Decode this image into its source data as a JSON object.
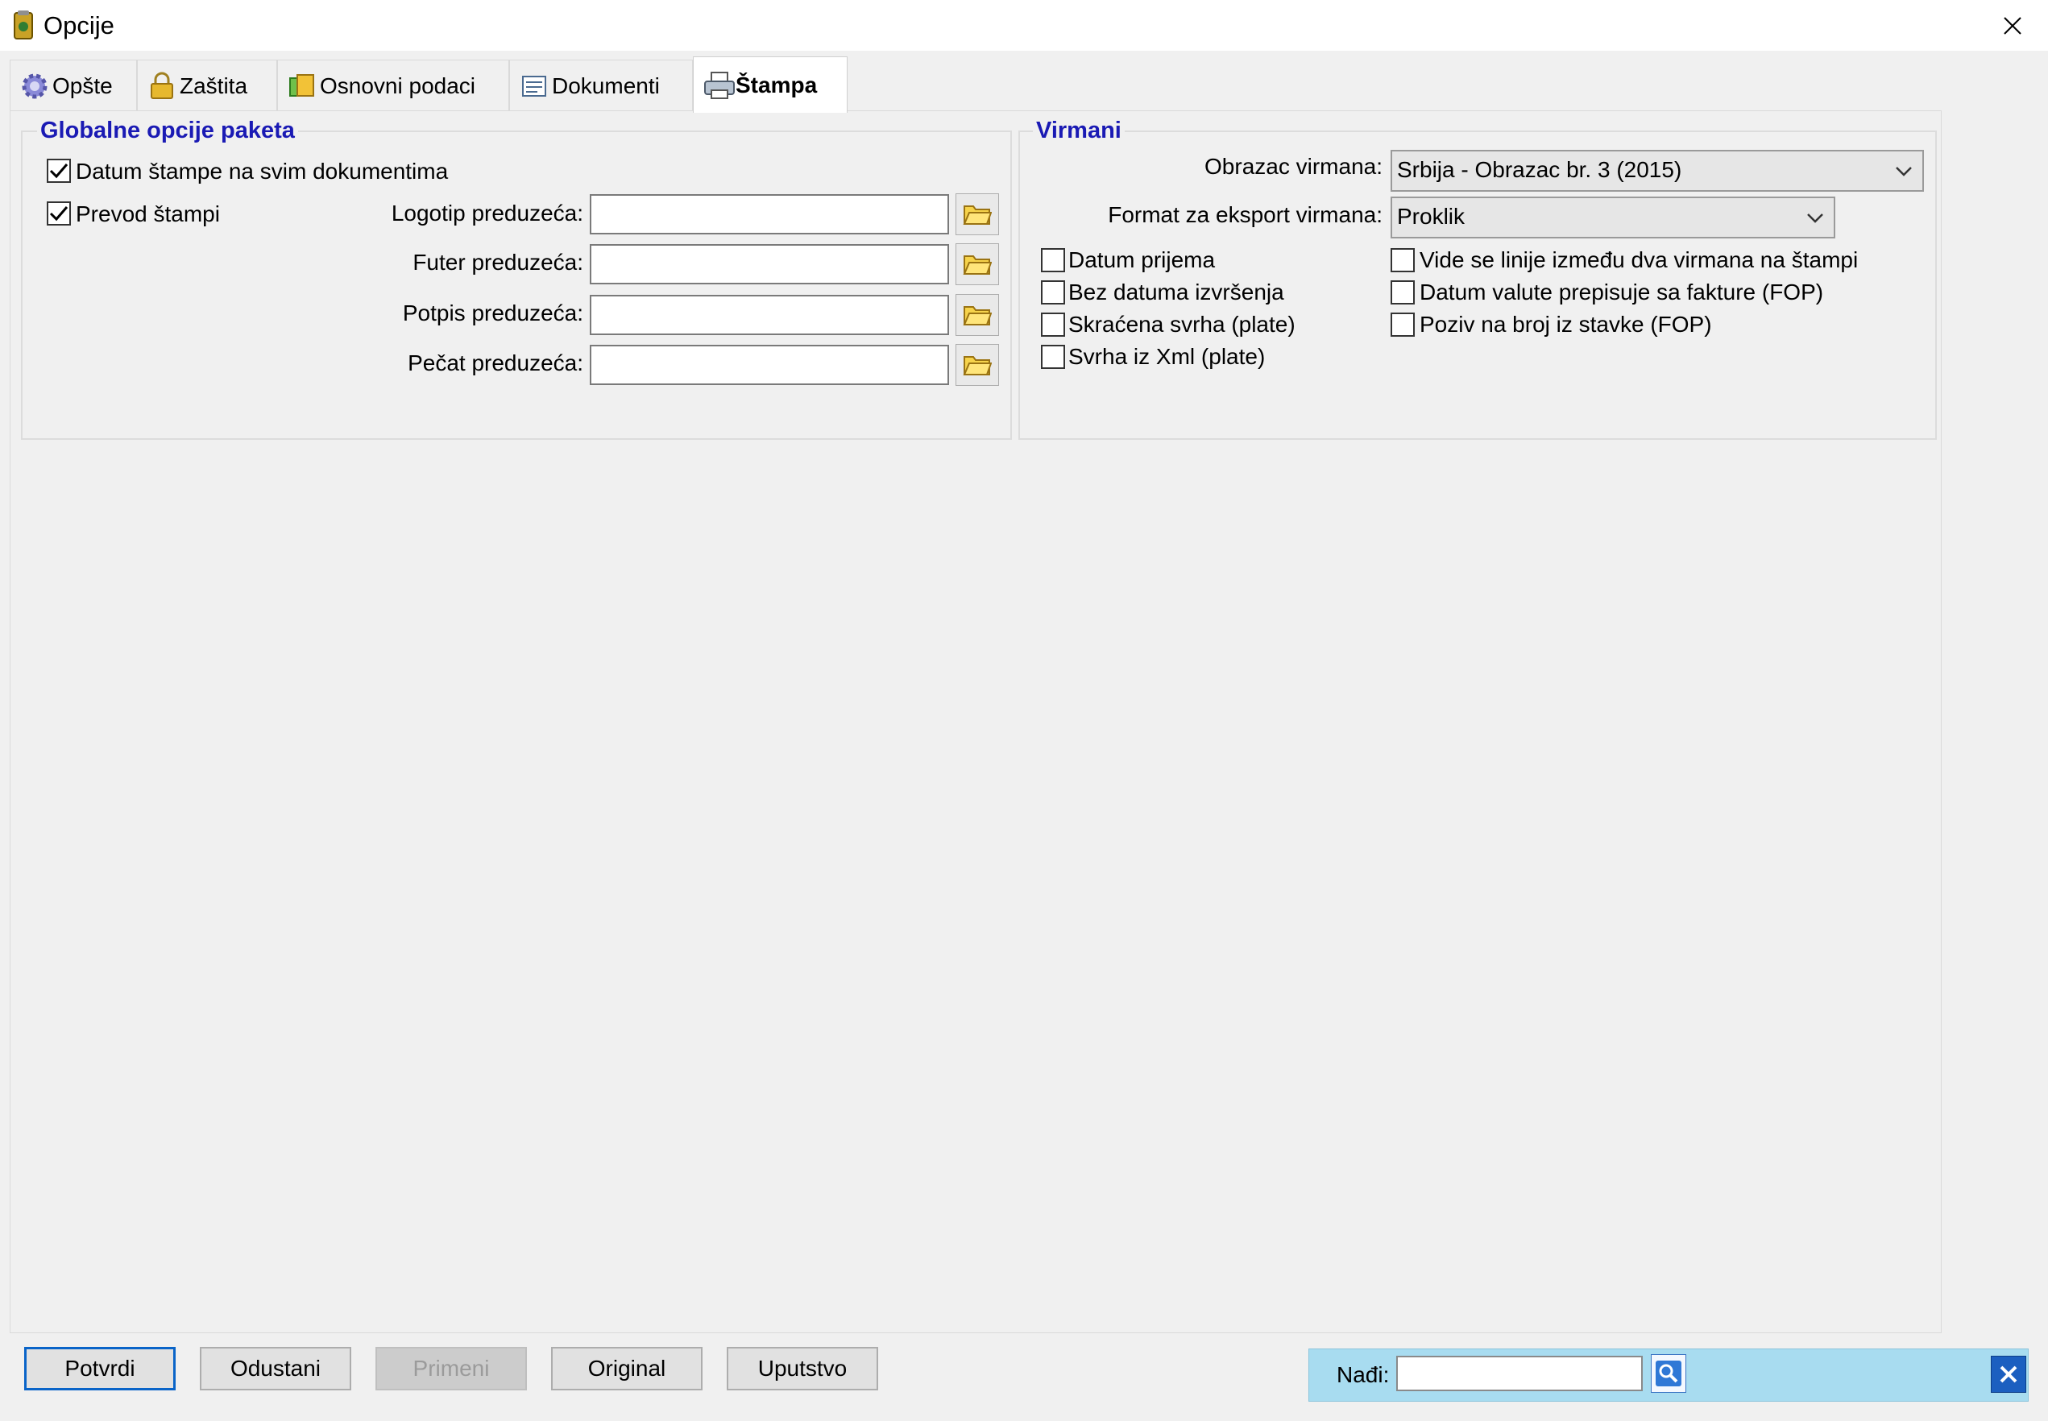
{
  "window": {
    "title": "Opcije"
  },
  "tabs": [
    {
      "label": "Opšte",
      "icon": "gear-icon"
    },
    {
      "label": "Zaštita",
      "icon": "lock-icon"
    },
    {
      "label": "Osnovni podaci",
      "icon": "database-icon"
    },
    {
      "label": "Dokumenti",
      "icon": "document-icon"
    },
    {
      "label": "Štampa",
      "icon": "printer-icon",
      "active": true
    }
  ],
  "global_group": {
    "title": "Globalne opcije paketa",
    "datum_stampe": {
      "label": "Datum štampe na svim dokumentima",
      "checked": true
    },
    "prevod_stampi": {
      "label": "Prevod štampi",
      "checked": true
    },
    "fields": [
      {
        "label": "Logotip preduzeća:",
        "value": ""
      },
      {
        "label": "Futer preduzeća:",
        "value": ""
      },
      {
        "label": "Potpis preduzeća:",
        "value": ""
      },
      {
        "label": "Pečat preduzeća:",
        "value": ""
      }
    ]
  },
  "virmani_group": {
    "title": "Virmani",
    "obrazac": {
      "label": "Obrazac virmana:",
      "value": "Srbija - Obrazac br. 3 (2015)"
    },
    "format": {
      "label": "Format za eksport virmana:",
      "value": "Proklik"
    },
    "left_checks": [
      {
        "label": "Datum prijema",
        "checked": false
      },
      {
        "label": "Bez datuma izvršenja",
        "checked": false
      },
      {
        "label": "Skraćena svrha (plate)",
        "checked": false
      },
      {
        "label": "Svrha iz Xml (plate)",
        "checked": false
      }
    ],
    "right_checks": [
      {
        "label": "Vide se linije između dva virmana na štampi",
        "checked": false
      },
      {
        "label": "Datum valute prepisuje sa fakture (FOP)",
        "checked": false
      },
      {
        "label": "Poziv na broj iz stavke (FOP)",
        "checked": false
      }
    ]
  },
  "buttons": {
    "potvrdi": "Potvrdi",
    "odustani": "Odustani",
    "primeni": "Primeni",
    "original": "Original",
    "uputstvo": "Uputstvo"
  },
  "find": {
    "label": "Nađi:",
    "value": ""
  },
  "colors": {
    "group_title": "#1a1ab4",
    "find_bar": "#a8dcf0",
    "default_button_border": "#0a64c8"
  }
}
